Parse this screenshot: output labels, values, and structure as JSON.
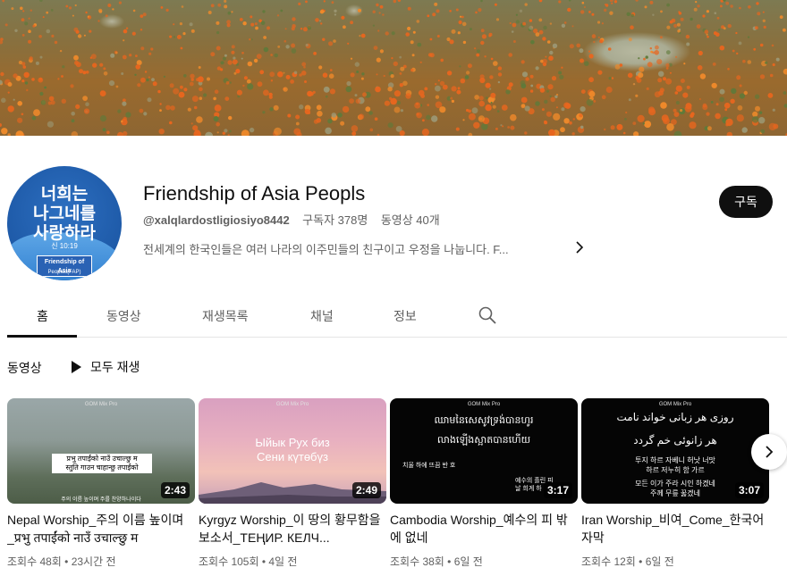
{
  "channel": {
    "avatar_lines": [
      "너희는",
      "나그네를",
      "사랑하라"
    ],
    "avatar_verse": "신 10:19",
    "avatar_badge": "Friendship of Asia",
    "avatar_badge2": "Peoples(FAP)",
    "name": "Friendship of Asia Peopls",
    "handle": "@xalqlardostligiosiyo8442",
    "subscribers": "구독자 378명",
    "video_count": "동영상 40개",
    "description": "전세계의 한국인들은 여러 나라의 이주민들의 친구이고 우정을 나눕니다. F...",
    "subscribe_label": "구독"
  },
  "tabs": [
    "홈",
    "동영상",
    "재생목록",
    "채널",
    "정보"
  ],
  "section": {
    "title": "동영상",
    "play_all": "모두 재생"
  },
  "videos": [
    {
      "title": "Nepal Worship_주의 이름 높이며_प्रभु तपाईंको नाउँ उचाल्छु म",
      "duration": "2:43",
      "meta": "조회수 48회 • 23시간 전",
      "thumb_lines": [
        "प्रभु तपाईंको नाउँ उचाल्छु म",
        "स्तुति गाउन चाहान्छु तपाईंको"
      ],
      "thumb_sub": "주의 이름 높이며 주를 찬양하나이다"
    },
    {
      "title": "Kyrgyz Worship_이 땅의 황무함을 보소서_ТЕҢИР. КЕЛЧ...",
      "duration": "2:49",
      "meta": "조회수 105회 • 4일 전",
      "thumb_lines": [
        "Ыйык Рух биз",
        "Сени күтөбүз"
      ]
    },
    {
      "title": "Cambodia Worship_예수의 피 밖에 없네",
      "duration": "3:17",
      "meta": "조회수 38회 • 6일 전",
      "thumb_lines": [
        "ឈាមនៃសេសូវទ្រង់បានហូរ",
        "លាងឡើងស្អាតបានហើយ"
      ],
      "thumb_sub": "치울 하에 뜨끔 반 호",
      "thumb_sub2": "예수의 흘린 피 날 희게 하"
    },
    {
      "title": "Iran Worship_비여_Come_한국어자막",
      "duration": "3:07",
      "meta": "조회수 12회 • 6일 전",
      "thumb_lines": [
        "روزی هر زبانی خواند نامت",
        "هر زانوئی خم گردد"
      ],
      "thumb_sub": "투지 하르 자베니 허낫 너맛",
      "thumb_sub2": "하르 저누히 함 가르",
      "thumb_sub3": "모든 이가 주라 시인 하겠네",
      "thumb_sub4": "주께 무릎 꿇겠네"
    }
  ],
  "gom_label": "GOM Mix Pro",
  "colors": {
    "subscribe_bg": "#0f0f0f",
    "avatar_bg": "#1e5aa8"
  }
}
